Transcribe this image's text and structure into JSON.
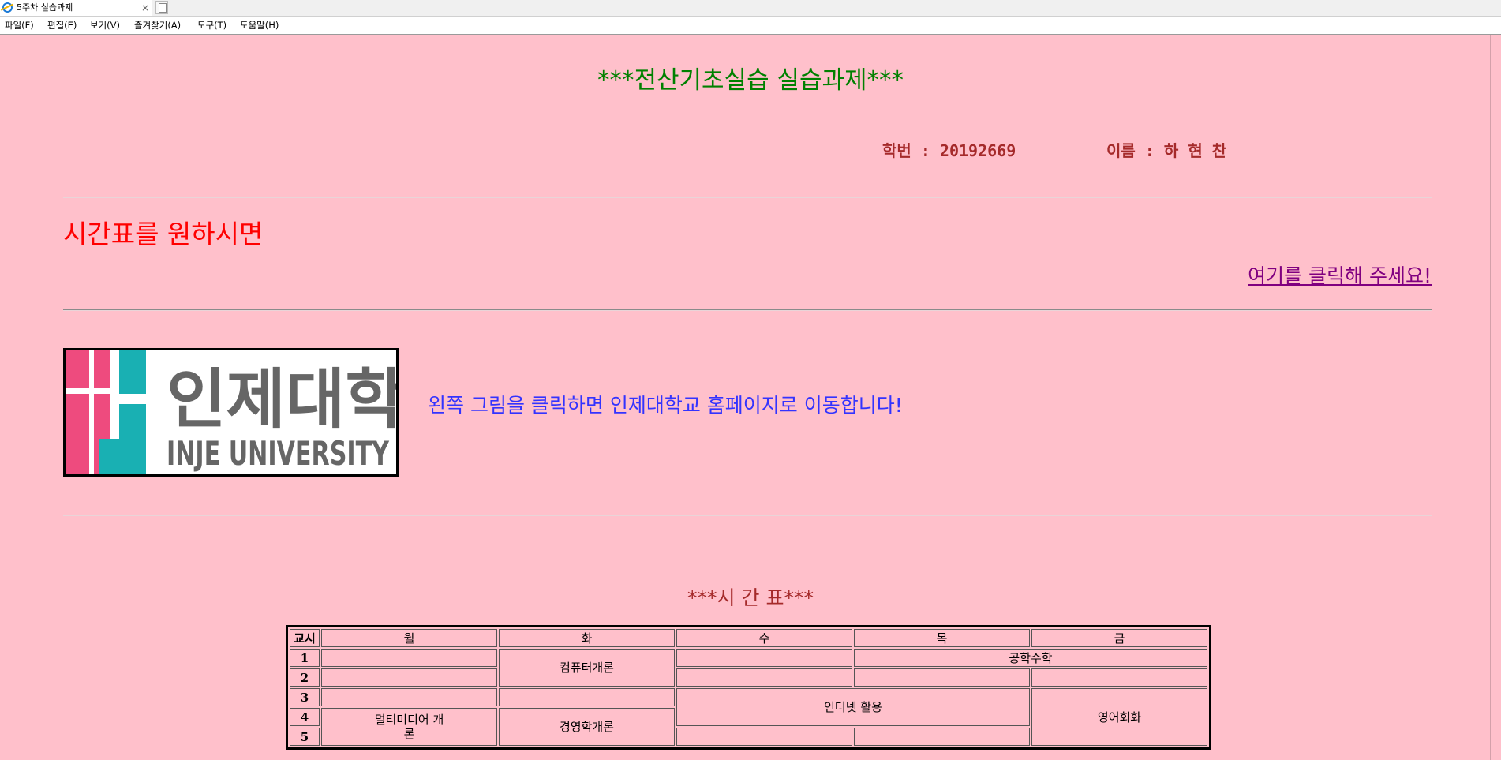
{
  "browser": {
    "tab_title": "5주차 실습과제",
    "close_glyph": "×",
    "menu": [
      "파일(F)",
      "편집(E)",
      "보기(V)",
      "즐겨찾기(A)",
      "도구(T)",
      "도움말(H)"
    ]
  },
  "page": {
    "title": "***전산기초실습 실습과제***",
    "student_id_text": "학번 : 20192669",
    "name_text": "이름 : 하 현 찬",
    "intro": "시간표를 원하시면",
    "link": "여기를 클릭해 주세요!",
    "logo": {
      "korean": "인제대학교",
      "english": "INJE UNIVERSITY",
      "colors": {
        "pink": "#ee4b7e",
        "teal": "#19b0b3",
        "text": "#666666"
      }
    },
    "logo_caption": "왼쪽 그림을 클릭하면 인제대학교 홈페이지로 이동합니다!",
    "timetable_title": "***시 간 표***"
  },
  "timetable": {
    "headers": [
      "교시",
      "월",
      "화",
      "수",
      "목",
      "금"
    ],
    "periods": [
      "1",
      "2",
      "3",
      "4",
      "5"
    ],
    "cells": {
      "tue_1_2": "컴퓨터개론",
      "thu_fri_1": "공학수학",
      "wed_thu_3_4": "인터넷 활용",
      "fri_4_5": "영어회화",
      "mon_4_5": "멀티미디어 개론",
      "tue_4_5": "경영학개론"
    }
  },
  "colors": {
    "background": "#ffc0cb",
    "title": "#008000",
    "info": "#a52a2a",
    "intro": "#ff0000",
    "link": "#800080",
    "caption": "#3333ff"
  }
}
